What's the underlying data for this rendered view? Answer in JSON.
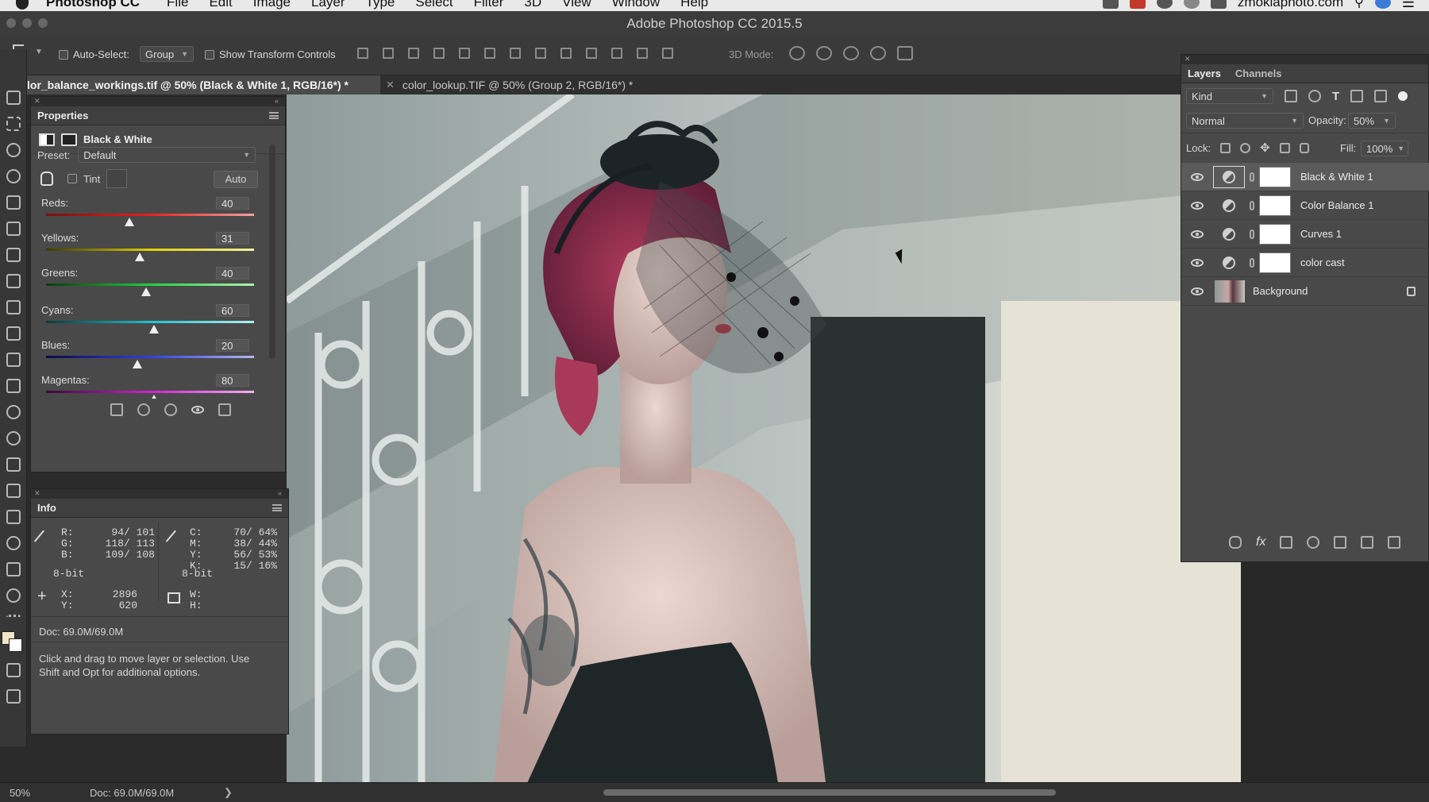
{
  "menubar": {
    "app_name": "Photoshop CC",
    "items": [
      "File",
      "Edit",
      "Image",
      "Layer",
      "Type",
      "Select",
      "Filter",
      "3D",
      "View",
      "Window",
      "Help"
    ],
    "right_text": "zmoklaphoto.com"
  },
  "window": {
    "title": "Adobe Photoshop CC 2015.5"
  },
  "options": {
    "auto_select_label": "Auto-Select:",
    "auto_select_value": "Group",
    "show_transform_label": "Show Transform Controls",
    "mode3d_label": "3D Mode:"
  },
  "tabs": [
    {
      "label": "lor_balance_workings.tif @ 50% (Black & White 1, RGB/16*) *",
      "active": true
    },
    {
      "label": "color_lookup.TIF @ 50% (Group 2, RGB/16*) *",
      "active": false
    }
  ],
  "properties": {
    "title": "Properties",
    "adjustment_name": "Black & White",
    "preset_label": "Preset:",
    "preset_value": "Default",
    "tint_label": "Tint",
    "auto_label": "Auto",
    "sliders": [
      {
        "label": "Reds:",
        "value": "40",
        "fraction": 0.4,
        "gradient": "linear-gradient(90deg,#7a1010,#e82020,#f0a0a0)"
      },
      {
        "label": "Yellows:",
        "value": "31",
        "fraction": 0.45,
        "gradient": "linear-gradient(90deg,#3a3a00,#e0d000,#f0f0a0)"
      },
      {
        "label": "Greens:",
        "value": "40",
        "fraction": 0.48,
        "gradient": "linear-gradient(90deg,#0a3a0a,#20d040,#b0f0b0)"
      },
      {
        "label": "Cyans:",
        "value": "60",
        "fraction": 0.52,
        "gradient": "linear-gradient(90deg,#0a3a3a,#20c0d0,#b0f0f0)"
      },
      {
        "label": "Blues:",
        "value": "20",
        "fraction": 0.44,
        "gradient": "linear-gradient(90deg,#0a0a4a,#3040e0,#b0b8f0)"
      },
      {
        "label": "Magentas:",
        "value": "80",
        "fraction": 0.52,
        "gradient": "linear-gradient(90deg,#3a0a3a,#d020d0,#f0b0f0)"
      }
    ]
  },
  "info": {
    "title": "Info",
    "rgb_labels": "R:\nG:\nB:",
    "rgb_values": "94/ 101\n118/ 113\n109/ 108",
    "cmyk_labels": "C:\nM:\nY:\nK:",
    "cmyk_values": "70/ 64%\n38/ 44%\n56/ 53%\n15/ 16%",
    "bit_left": "8-bit",
    "bit_right": "8-bit",
    "xy_labels": "X:\nY:",
    "xy_values": "2896\n620",
    "wh_labels": "W:\nH:",
    "doc": "Doc: 69.0M/69.0M",
    "hint": "Click and drag to move layer or selection.  Use Shift and Opt for additional options."
  },
  "layers_panel": {
    "tab_layers": "Layers",
    "tab_channels": "Channels",
    "kind_label": "Kind",
    "blend_mode": "Normal",
    "opacity_label": "Opacity:",
    "opacity_value": "50%",
    "lock_label": "Lock:",
    "fill_label": "Fill:",
    "fill_value": "100%",
    "layers": [
      {
        "name": "Black & White 1",
        "type": "adjustment",
        "selected": true
      },
      {
        "name": "Color Balance 1",
        "type": "adjustment",
        "selected": false
      },
      {
        "name": "Curves 1",
        "type": "adjustment",
        "selected": false
      },
      {
        "name": "color cast",
        "type": "adjustment",
        "selected": false
      },
      {
        "name": "Background",
        "type": "image",
        "selected": false,
        "locked": true
      }
    ]
  },
  "status": {
    "zoom": "50%",
    "doc": "Doc: 69.0M/69.0M"
  },
  "colors": {
    "panel_bg": "#494949",
    "selected_layer": "#5a5a5a",
    "canvas_bg": "#9aa6a4"
  }
}
